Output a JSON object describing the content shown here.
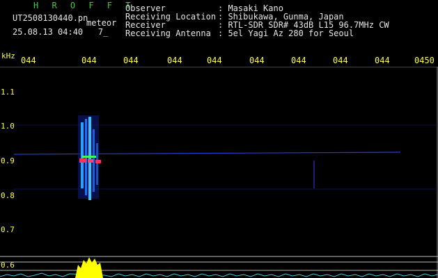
{
  "header": {
    "program": "H R O F F T",
    "filename": "UT2508130440.pn",
    "meteor_label": "meteor",
    "datetime": "25.08.13 04:40",
    "index": "7_"
  },
  "meta": {
    "labels": [
      "Observer",
      "Receiving Location",
      "Receiver",
      "Receiving Antenna"
    ],
    "values": [
      ": Masaki Kano",
      ": Shibukawa, Gunma, Japan",
      ": RTL-SDR SDR# 43dB L15 96.7MHz CW",
      ": 5el Yagi Az 280 for Seoul"
    ]
  },
  "axis": {
    "unit": "kHz",
    "x_ticks": [
      "044",
      "044",
      "044",
      "044",
      "044",
      "044",
      "044",
      "044",
      "044",
      "0450"
    ],
    "y_ticks": [
      "1.1",
      "1.0",
      "0.9",
      "0.8",
      "0.7",
      "0.6"
    ]
  },
  "colors": {
    "background": "#000000",
    "text_green": "#36d436",
    "text_yellow": "#ffff4d",
    "trace_blue": "#2a3fd8",
    "spectrum_cyan": "#40c8e0",
    "meteor_yellow": "#ffff00"
  }
}
